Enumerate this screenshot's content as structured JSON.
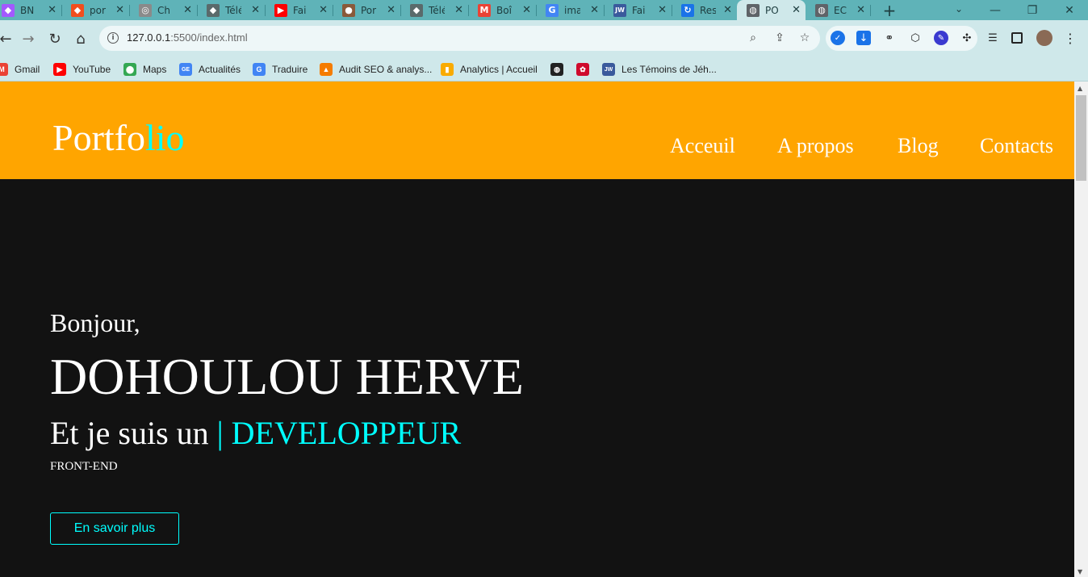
{
  "browser": {
    "tabs": [
      {
        "title": "BN",
        "icon": "figma-icon",
        "color": "#a259ff"
      },
      {
        "title": "por",
        "icon": "figma-icon",
        "color": "#f24e1e"
      },
      {
        "title": "Ch",
        "icon": "chatgpt-icon",
        "color": "#8a8a8a"
      },
      {
        "title": "Télé",
        "icon": "graduation-icon",
        "color": "#5a6a6b"
      },
      {
        "title": "Fai",
        "icon": "youtube-icon",
        "color": "#ff0000"
      },
      {
        "title": "Por",
        "icon": "avatar-icon",
        "color": "#8a5a3a"
      },
      {
        "title": "Télé",
        "icon": "graduation-icon",
        "color": "#5a6a6b"
      },
      {
        "title": "Boî",
        "icon": "gmail-icon",
        "color": "#ea4335"
      },
      {
        "title": "ima",
        "icon": "google-icon",
        "color": "#4285f4"
      },
      {
        "title": "Fai",
        "icon": "jw-icon",
        "color": "#3a5a9c"
      },
      {
        "title": "Res",
        "icon": "refresh-icon",
        "color": "#1a73e8"
      },
      {
        "title": "PO",
        "icon": "globe-icon",
        "color": "#5f6368"
      },
      {
        "title": "EC",
        "icon": "globe-icon",
        "color": "#5f6368"
      }
    ],
    "url_host": "127.0.0.1",
    "url_path": ":5500/index.html",
    "bookmarks": [
      {
        "label": "Gmail",
        "icon": "gmail-icon",
        "color": "#ea4335"
      },
      {
        "label": "YouTube",
        "icon": "youtube-icon",
        "color": "#ff0000"
      },
      {
        "label": "Maps",
        "icon": "maps-icon",
        "color": "#34a853"
      },
      {
        "label": "Actualités",
        "icon": "news-icon",
        "color": "#4285f4"
      },
      {
        "label": "Traduire",
        "icon": "translate-icon",
        "color": "#4285f4"
      },
      {
        "label": "Audit SEO & analys...",
        "icon": "seo-icon",
        "color": "#f57c00"
      },
      {
        "label": "Analytics | Accueil",
        "icon": "analytics-icon",
        "color": "#f9ab00"
      },
      {
        "label": "",
        "icon": "globe-icon",
        "color": "#222222"
      },
      {
        "label": "",
        "icon": "huawei-icon",
        "color": "#cf0a2c"
      },
      {
        "label": "Les Témoins de Jéh...",
        "icon": "jw-icon",
        "color": "#3a5a9c"
      }
    ]
  },
  "site": {
    "logo_main": "Portfo",
    "logo_accent": "lio",
    "nav": [
      "Acceuil",
      "A propos",
      "Blog",
      "Contacts"
    ],
    "greeting": "Bonjour,",
    "name": "DOHOULOU HERVE",
    "role_prefix": "Et je suis un ",
    "role_accent": "| DEVELOPPEUR",
    "role_sub": "FRONT-END",
    "cta": "En savoir plus"
  },
  "colors": {
    "header": "#ffa500",
    "background": "#121212",
    "accent": "#00ffff",
    "tabstrip": "#5fb3b8",
    "toolbar": "#cfe8ea"
  }
}
